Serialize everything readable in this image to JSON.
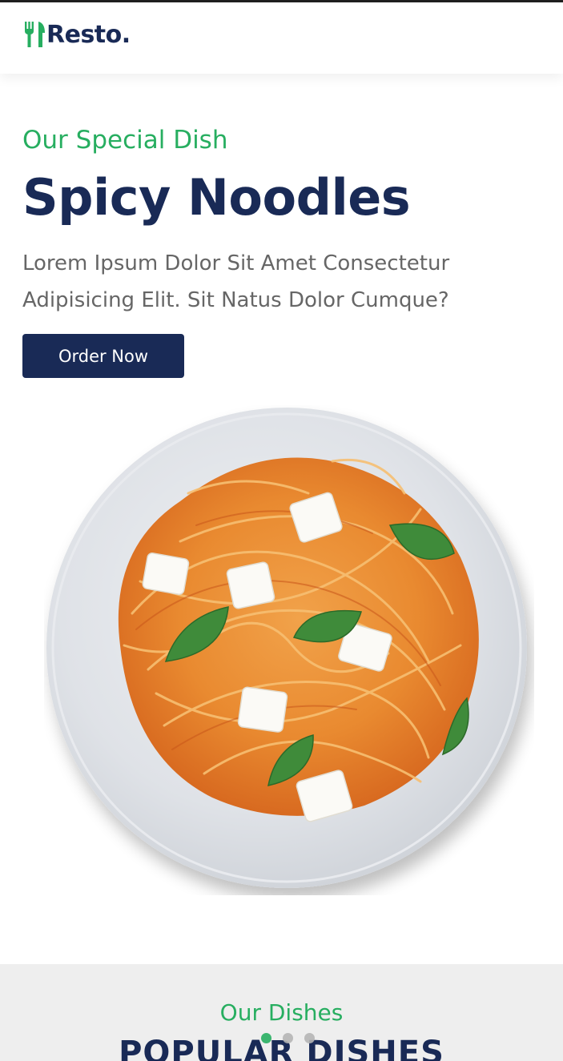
{
  "brand": {
    "logo_text": "Resto.",
    "logo_icon": "utensils-icon",
    "accent_color": "#27ae60",
    "primary_color": "#192a56"
  },
  "hero": {
    "subtitle": "Our Special Dish",
    "title": "Spicy Noodles",
    "description": "Lorem Ipsum Dolor Sit Amet Consectetur Adipisicing Elit. Sit Natus Dolor Cumque?",
    "button_label": "Order Now",
    "image_alt": "spaghetti-plate-image"
  },
  "carousel": {
    "dots": 3,
    "active_index": 0
  },
  "dishes": {
    "subtitle": "Our Dishes",
    "title": "POPULAR DISHES"
  }
}
